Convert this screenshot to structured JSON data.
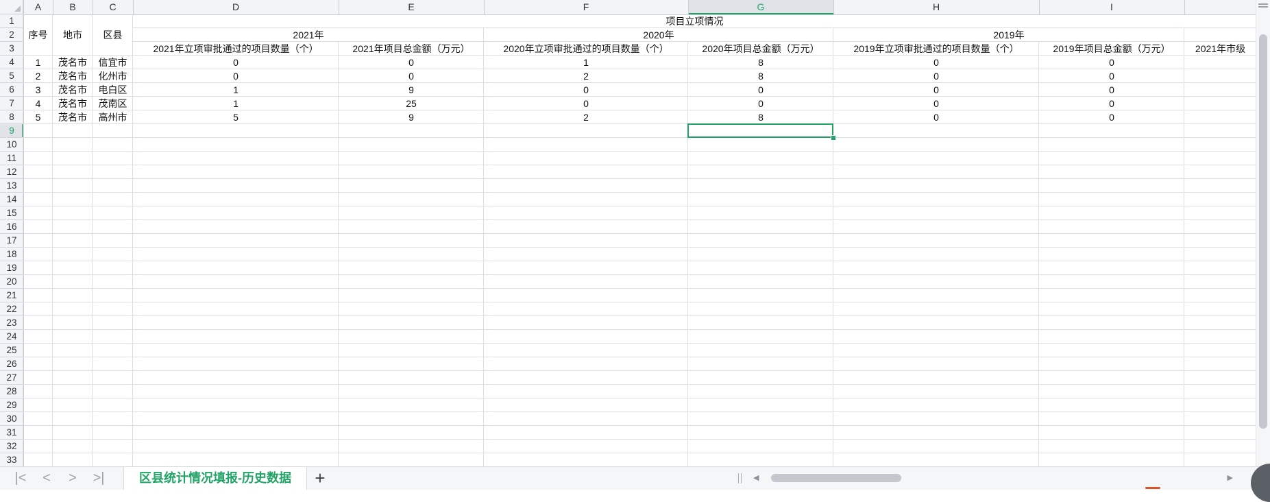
{
  "columns": [
    "A",
    "B",
    "C",
    "D",
    "E",
    "F",
    "G",
    "H",
    "I"
  ],
  "selected_column": "G",
  "row_numbers": [
    "1",
    "2",
    "3",
    "4",
    "5",
    "6",
    "7",
    "8",
    "9",
    "10",
    "11",
    "12",
    "13",
    "14",
    "15",
    "16",
    "17",
    "18",
    "19",
    "20",
    "21",
    "22",
    "23",
    "24",
    "25",
    "26",
    "27",
    "28",
    "29",
    "30",
    "31",
    "32",
    "33"
  ],
  "selected_row": "9",
  "header": {
    "seq": "序号",
    "city": "地市",
    "county": "区县",
    "group_title": "项目立项情况",
    "year_2021": "2021年",
    "year_2020": "2020年",
    "year_2019": "2019年",
    "d3": "2021年立项审批通过的项目数量（个）",
    "e3": "2021年项目总金额（万元）",
    "f3": "2020年立项审批通过的项目数量（个）",
    "g3": "2020年项目总金额（万元）",
    "h3": "2019年立项审批通过的项目数量（个）",
    "i3": "2019年项目总金额（万元）",
    "j3": "2021年市级"
  },
  "rows": [
    {
      "seq": "1",
      "city": "茂名市",
      "county": "信宜市",
      "d": "0",
      "e": "0",
      "f": "1",
      "g": "8",
      "h": "0",
      "i": "0"
    },
    {
      "seq": "2",
      "city": "茂名市",
      "county": "化州市",
      "d": "0",
      "e": "0",
      "f": "2",
      "g": "8",
      "h": "0",
      "i": "0"
    },
    {
      "seq": "3",
      "city": "茂名市",
      "county": "电白区",
      "d": "1",
      "e": "9",
      "f": "0",
      "g": "0",
      "h": "0",
      "i": "0"
    },
    {
      "seq": "4",
      "city": "茂名市",
      "county": "茂南区",
      "d": "1",
      "e": "25",
      "f": "0",
      "g": "0",
      "h": "0",
      "i": "0"
    },
    {
      "seq": "5",
      "city": "茂名市",
      "county": "高州市",
      "d": "5",
      "e": "9",
      "f": "2",
      "g": "8",
      "h": "0",
      "i": "0"
    }
  ],
  "sheet_tab": "区县统计情况填报-历史数据",
  "add_tab": "+",
  "colors": {
    "accent": "#21a366",
    "grid": "#dcdfe6",
    "header_bg": "#f3f4f7"
  }
}
